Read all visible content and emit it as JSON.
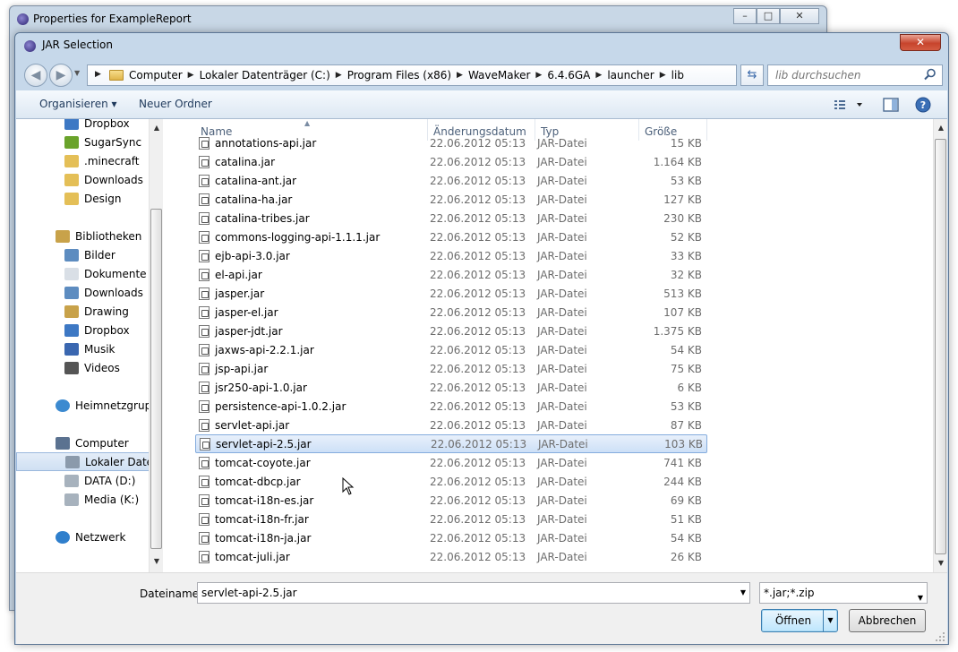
{
  "parent_window": {
    "title": "Properties for ExampleReport",
    "min": "–",
    "max": "□",
    "close": "✕"
  },
  "dialog": {
    "title": "JAR Selection",
    "close": "✕"
  },
  "address": {
    "crumbs": [
      "Computer",
      "Lokaler Datenträger (C:)",
      "Program Files (x86)",
      "WaveMaker",
      "6.4.6GA",
      "launcher",
      "lib"
    ],
    "search_placeholder": "lib durchsuchen"
  },
  "toolbar": {
    "organize": "Organisieren ▾",
    "new_folder": "Neuer Ordner"
  },
  "nav": {
    "items": [
      {
        "label": "Dropbox",
        "icon": "dropbox-icon",
        "indent": 1
      },
      {
        "label": "SugarSync",
        "icon": "sugarsync-icon",
        "indent": 1
      },
      {
        "label": ".minecraft",
        "icon": "folder-icon",
        "indent": 1
      },
      {
        "label": "Downloads",
        "icon": "folder-icon",
        "indent": 1
      },
      {
        "label": "Design",
        "icon": "folder-icon",
        "indent": 1
      },
      {
        "label": "Bibliotheken",
        "icon": "library-icon",
        "indent": 0
      },
      {
        "label": "Bilder",
        "icon": "pictures-icon",
        "indent": 1
      },
      {
        "label": "Dokumente",
        "icon": "documents-icon",
        "indent": 1
      },
      {
        "label": "Downloads",
        "icon": "downloads-icon",
        "indent": 1
      },
      {
        "label": "Drawing",
        "icon": "drawing-icon",
        "indent": 1
      },
      {
        "label": "Dropbox",
        "icon": "dropbox-icon",
        "indent": 1
      },
      {
        "label": "Musik",
        "icon": "music-icon",
        "indent": 1
      },
      {
        "label": "Videos",
        "icon": "videos-icon",
        "indent": 1
      },
      {
        "label": "Heimnetzgruppe",
        "icon": "homegroup-icon",
        "indent": 0
      },
      {
        "label": "Computer",
        "icon": "computer-icon",
        "indent": 0
      },
      {
        "label": "Lokaler Datenträger (C:)",
        "icon": "drive-c-icon",
        "indent": 1,
        "selected": true
      },
      {
        "label": "DATA (D:)",
        "icon": "drive-icon",
        "indent": 1
      },
      {
        "label": "Media (K:)",
        "icon": "drive-icon",
        "indent": 1
      },
      {
        "label": "Netzwerk",
        "icon": "network-icon",
        "indent": 0
      }
    ]
  },
  "columns": {
    "name": "Name",
    "date": "Änderungsdatum",
    "type": "Typ",
    "size": "Größe"
  },
  "files": [
    {
      "name": "annotations-api.jar",
      "date": "22.06.2012 05:13",
      "type": "JAR-Datei",
      "size": "15 KB"
    },
    {
      "name": "catalina.jar",
      "date": "22.06.2012 05:13",
      "type": "JAR-Datei",
      "size": "1.164 KB"
    },
    {
      "name": "catalina-ant.jar",
      "date": "22.06.2012 05:13",
      "type": "JAR-Datei",
      "size": "53 KB"
    },
    {
      "name": "catalina-ha.jar",
      "date": "22.06.2012 05:13",
      "type": "JAR-Datei",
      "size": "127 KB"
    },
    {
      "name": "catalina-tribes.jar",
      "date": "22.06.2012 05:13",
      "type": "JAR-Datei",
      "size": "230 KB"
    },
    {
      "name": "commons-logging-api-1.1.1.jar",
      "date": "22.06.2012 05:13",
      "type": "JAR-Datei",
      "size": "52 KB"
    },
    {
      "name": "ejb-api-3.0.jar",
      "date": "22.06.2012 05:13",
      "type": "JAR-Datei",
      "size": "33 KB"
    },
    {
      "name": "el-api.jar",
      "date": "22.06.2012 05:13",
      "type": "JAR-Datei",
      "size": "32 KB"
    },
    {
      "name": "jasper.jar",
      "date": "22.06.2012 05:13",
      "type": "JAR-Datei",
      "size": "513 KB"
    },
    {
      "name": "jasper-el.jar",
      "date": "22.06.2012 05:13",
      "type": "JAR-Datei",
      "size": "107 KB"
    },
    {
      "name": "jasper-jdt.jar",
      "date": "22.06.2012 05:13",
      "type": "JAR-Datei",
      "size": "1.375 KB"
    },
    {
      "name": "jaxws-api-2.2.1.jar",
      "date": "22.06.2012 05:13",
      "type": "JAR-Datei",
      "size": "54 KB"
    },
    {
      "name": "jsp-api.jar",
      "date": "22.06.2012 05:13",
      "type": "JAR-Datei",
      "size": "75 KB"
    },
    {
      "name": "jsr250-api-1.0.jar",
      "date": "22.06.2012 05:13",
      "type": "JAR-Datei",
      "size": "6 KB"
    },
    {
      "name": "persistence-api-1.0.2.jar",
      "date": "22.06.2012 05:13",
      "type": "JAR-Datei",
      "size": "53 KB"
    },
    {
      "name": "servlet-api.jar",
      "date": "22.06.2012 05:13",
      "type": "JAR-Datei",
      "size": "87 KB"
    },
    {
      "name": "servlet-api-2.5.jar",
      "date": "22.06.2012 05:13",
      "type": "JAR-Datei",
      "size": "103 KB",
      "selected": true
    },
    {
      "name": "tomcat-coyote.jar",
      "date": "22.06.2012 05:13",
      "type": "JAR-Datei",
      "size": "741 KB"
    },
    {
      "name": "tomcat-dbcp.jar",
      "date": "22.06.2012 05:13",
      "type": "JAR-Datei",
      "size": "244 KB"
    },
    {
      "name": "tomcat-i18n-es.jar",
      "date": "22.06.2012 05:13",
      "type": "JAR-Datei",
      "size": "69 KB"
    },
    {
      "name": "tomcat-i18n-fr.jar",
      "date": "22.06.2012 05:13",
      "type": "JAR-Datei",
      "size": "51 KB"
    },
    {
      "name": "tomcat-i18n-ja.jar",
      "date": "22.06.2012 05:13",
      "type": "JAR-Datei",
      "size": "54 KB"
    },
    {
      "name": "tomcat-juli.jar",
      "date": "22.06.2012 05:13",
      "type": "JAR-Datei",
      "size": "26 KB"
    }
  ],
  "bottom": {
    "filename_label": "Dateiname:",
    "filename_value": "servlet-api-2.5.jar",
    "filetype": "*.jar;*.zip",
    "open": "Öffnen",
    "cancel": "Abbrechen"
  },
  "colors": {
    "selection": "#cde0f7",
    "toolbar_text": "#1e395b",
    "accent": "#3c7fb1"
  }
}
